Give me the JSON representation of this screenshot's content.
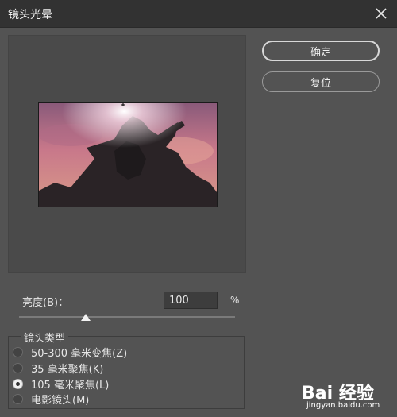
{
  "window": {
    "title": "镜头光晕"
  },
  "buttons": {
    "ok": "确定",
    "reset": "复位"
  },
  "brightness": {
    "label_pre": "亮度(",
    "label_key": "B",
    "label_post": ")：",
    "value": "100",
    "unit": "%",
    "slider_percent": 100
  },
  "lens_type": {
    "title": "镜头类型",
    "options": [
      {
        "label": "50-300 毫米变焦(Z)",
        "selected": false
      },
      {
        "label": "35 毫米聚焦(K)",
        "selected": false
      },
      {
        "label": "105 毫米聚焦(L)",
        "selected": true
      },
      {
        "label": "电影镜头(M)",
        "selected": false
      }
    ]
  },
  "watermark": {
    "brand": "Bai 经验",
    "url": "jingyan.baidu.com"
  },
  "colors": {
    "background": "#535353",
    "titlebar": "#323232"
  }
}
